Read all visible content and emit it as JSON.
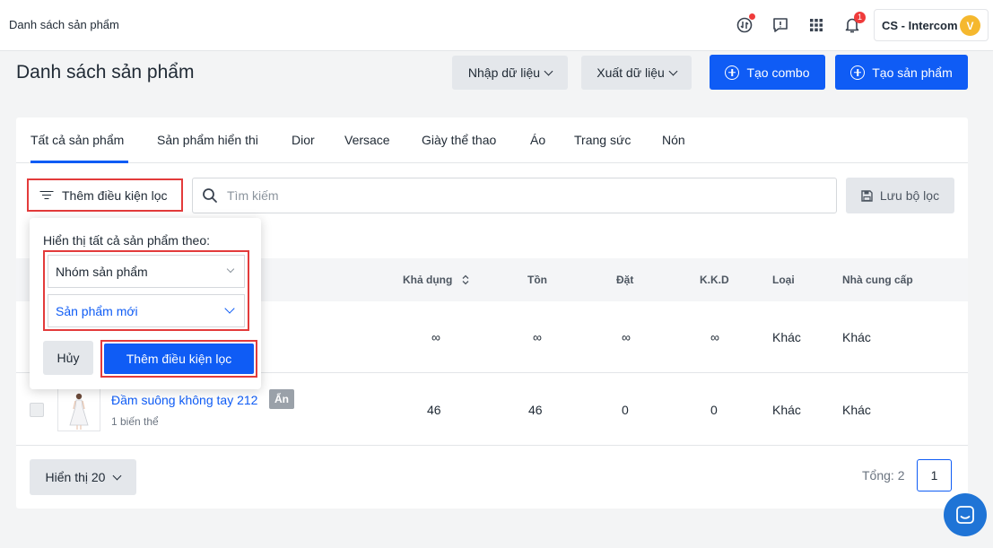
{
  "topbar": {
    "breadcrumb": "Danh sách sản phẩm",
    "notification_count": "1",
    "account_name": "CS - Intercom",
    "avatar_initial": "V"
  },
  "header": {
    "title": "Danh sách sản phẩm",
    "import_label": "Nhập dữ liệu",
    "export_label": "Xuất dữ liệu",
    "create_combo_label": "Tạo combo",
    "create_product_label": "Tạo sản phẩm"
  },
  "tabs": [
    {
      "label": "Tất cả sản phẩm",
      "active": true
    },
    {
      "label": "Sản phẩm hiển thi"
    },
    {
      "label": "Dior"
    },
    {
      "label": "Versace"
    },
    {
      "label": "Giày thể thao"
    },
    {
      "label": "Áo"
    },
    {
      "label": "Trang sức"
    },
    {
      "label": "Nón"
    }
  ],
  "filter": {
    "add_filter_label": "Thêm điều kiện lọc",
    "search_placeholder": "Tìm kiếm",
    "save_filter_label": "Lưu bộ lọc"
  },
  "table": {
    "columns": [
      "Khả dụng",
      "Tồn",
      "Đặt",
      "K.K.D",
      "Loại",
      "Nhà cung cấp"
    ],
    "rows": [
      {
        "available": "∞",
        "stock": "∞",
        "ordered": "∞",
        "kkd": "∞",
        "type": "Khác",
        "supplier": "Khác"
      },
      {
        "name": "Đầm suông không tay 212",
        "badge": "Ẩn",
        "variants": "1 biến thể",
        "available": "46",
        "stock": "46",
        "ordered": "0",
        "kkd": "0",
        "type": "Khác",
        "supplier": "Khác"
      }
    ]
  },
  "footer": {
    "page_size_label": "Hiển thị 20",
    "total_label": "Tổng: 2",
    "current_page": "1"
  },
  "popover": {
    "label": "Hiển thị tất cả sản phẩm theo:",
    "field_select": "Nhóm sản phẩm",
    "value_select": "Sản phẩm mới",
    "cancel_label": "Hủy",
    "apply_label": "Thêm điều kiện lọc"
  },
  "colors": {
    "primary": "#0f5cf5",
    "highlight": "#e33b3b",
    "badge_red": "#ef3b3b",
    "avatar": "#f5b82e"
  }
}
